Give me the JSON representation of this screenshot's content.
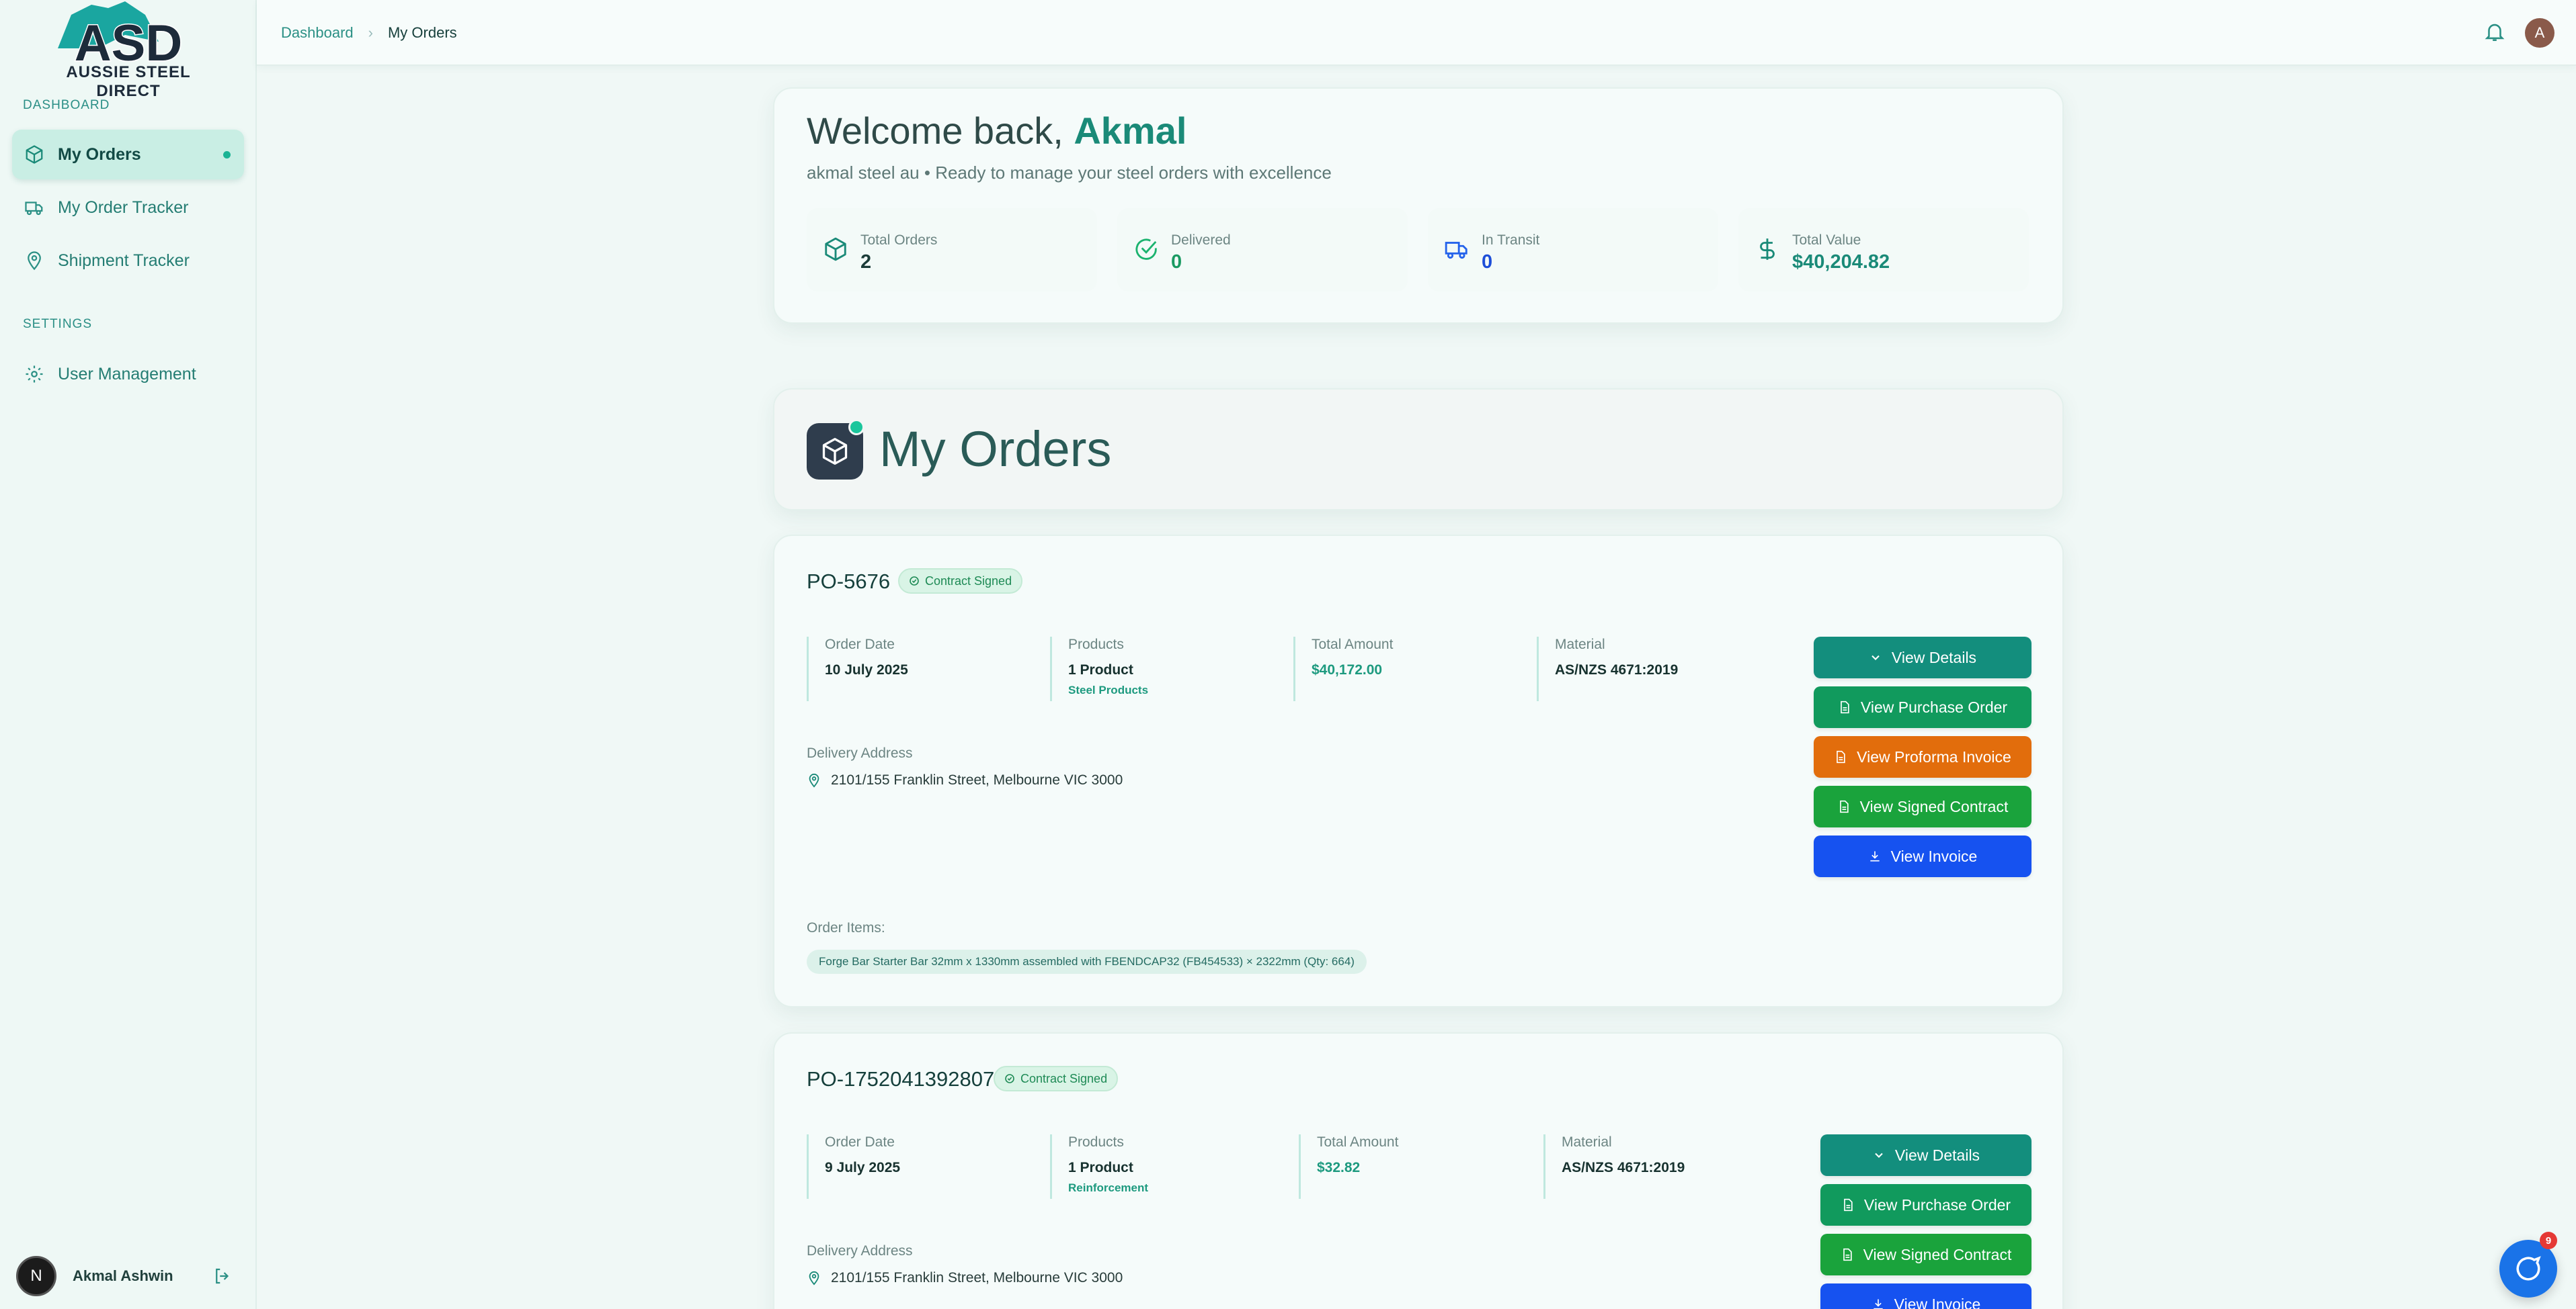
{
  "sidebar": {
    "logo_text": "AUSSIE STEEL DIRECT",
    "section_dashboard": "DASHBOARD",
    "section_settings": "SETTINGS",
    "items": [
      {
        "label": "My Orders",
        "icon": "package-icon",
        "active": true
      },
      {
        "label": "My Order Tracker",
        "icon": "truck-icon"
      },
      {
        "label": "Shipment Tracker",
        "icon": "map-pin-icon"
      },
      {
        "label": "User Management",
        "icon": "gear-icon"
      }
    ],
    "user": {
      "initial": "N",
      "name": "Akmal Ashwin"
    }
  },
  "topbar": {
    "breadcrumb": [
      "Dashboard",
      "My Orders"
    ],
    "avatar_initial": "A"
  },
  "welcome": {
    "greeting": "Welcome back,",
    "name": "Akmal",
    "subtitle": "akmal steel au • Ready to manage your steel orders with excellence",
    "stats": [
      {
        "label": "Total Orders",
        "value": "2",
        "icon": "package-icon"
      },
      {
        "label": "Delivered",
        "value": "0",
        "icon": "check-circle-icon"
      },
      {
        "label": "In Transit",
        "value": "0",
        "icon": "truck-icon"
      },
      {
        "label": "Total Value",
        "value": "$40,204.82",
        "icon": "dollar-icon"
      }
    ]
  },
  "orders_header": {
    "title": "My Orders"
  },
  "labels": {
    "order_date": "Order Date",
    "products": "Products",
    "total_amount": "Total Amount",
    "material": "Material",
    "delivery_address": "Delivery Address",
    "order_items": "Order Items:"
  },
  "orders": [
    {
      "po": "PO-5676",
      "status": "Contract Signed",
      "order_date": "10 July 2025",
      "products": "1 Product",
      "product_category": "Steel Products",
      "total_amount": "$40,172.00",
      "material": "AS/NZS 4671:2019",
      "address": "2101/155 Franklin Street, Melbourne VIC 3000",
      "item": "Forge Bar Starter Bar 32mm x 1330mm assembled with FBENDCAP32 (FB454533) × 2322mm (Qty: 664)",
      "buttons": [
        "View Details",
        "View Purchase Order",
        "View Proforma Invoice",
        "View Signed Contract",
        "View Invoice"
      ]
    },
    {
      "po": "PO-1752041392807",
      "status": "Contract Signed",
      "order_date": "9 July 2025",
      "products": "1 Product",
      "product_category": "Reinforcement",
      "total_amount": "$32.82",
      "material": "AS/NZS 4671:2019",
      "address": "2101/155 Franklin Street, Melbourne VIC 3000",
      "buttons": [
        "View Details",
        "View Purchase Order",
        "View Signed Contract",
        "View Invoice"
      ]
    }
  ],
  "chat": {
    "badge": "9"
  },
  "colors": {
    "accent": "#138e7d",
    "orange": "#e26d0c",
    "blue": "#1652f0",
    "green": "#119a5d"
  }
}
